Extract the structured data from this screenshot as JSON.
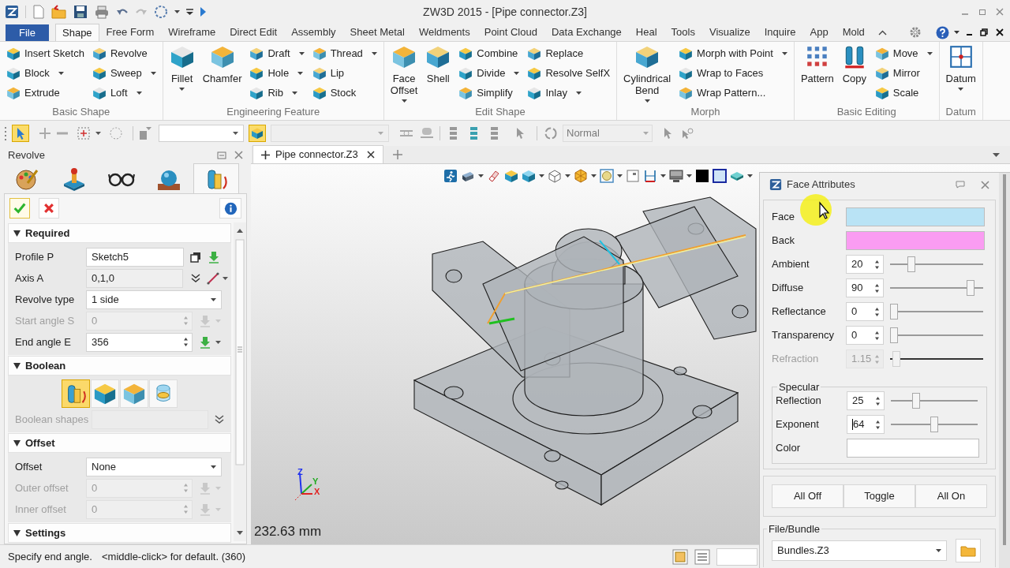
{
  "window": {
    "title": "ZW3D 2015 - [Pipe connector.Z3]"
  },
  "menu_tabs": [
    {
      "label": "File",
      "kind": "file",
      "selected": false
    },
    {
      "label": "Shape",
      "kind": "tab",
      "selected": true
    },
    {
      "label": "Free Form",
      "kind": "tab",
      "selected": false
    },
    {
      "label": "Wireframe",
      "kind": "tab",
      "selected": false
    },
    {
      "label": "Direct Edit",
      "kind": "tab",
      "selected": false
    },
    {
      "label": "Assembly",
      "kind": "tab",
      "selected": false
    },
    {
      "label": "Sheet Metal",
      "kind": "tab",
      "selected": false
    },
    {
      "label": "Weldments",
      "kind": "tab",
      "selected": false
    },
    {
      "label": "Point Cloud",
      "kind": "tab",
      "selected": false
    },
    {
      "label": "Data Exchange",
      "kind": "tab",
      "selected": false
    },
    {
      "label": "Heal",
      "kind": "tab",
      "selected": false
    },
    {
      "label": "Tools",
      "kind": "tab",
      "selected": false
    },
    {
      "label": "Visualize",
      "kind": "tab",
      "selected": false
    },
    {
      "label": "Inquire",
      "kind": "tab",
      "selected": false
    },
    {
      "label": "App",
      "kind": "tab",
      "selected": false
    },
    {
      "label": "Mold",
      "kind": "tab",
      "selected": false
    }
  ],
  "ribbon": {
    "groups": [
      {
        "title": "Basic Shape",
        "items": [
          {
            "label": "Insert Sketch",
            "kind": "small",
            "dropdown": false
          },
          {
            "label": "Block",
            "kind": "small",
            "dropdown": true
          },
          {
            "label": "Extrude",
            "kind": "small",
            "dropdown": false
          },
          {
            "label": "Revolve",
            "kind": "small",
            "dropdown": false
          },
          {
            "label": "Sweep",
            "kind": "small",
            "dropdown": true
          },
          {
            "label": "Loft",
            "kind": "small",
            "dropdown": true
          }
        ]
      },
      {
        "title": "Engineering Feature",
        "items": [
          {
            "label": "Fillet",
            "kind": "large",
            "dropdown": true
          },
          {
            "label": "Chamfer",
            "kind": "large",
            "dropdown": false
          },
          {
            "label": "Draft",
            "kind": "small",
            "dropdown": true
          },
          {
            "label": "Hole",
            "kind": "small",
            "dropdown": true
          },
          {
            "label": "Rib",
            "kind": "small",
            "dropdown": true
          },
          {
            "label": "Thread",
            "kind": "small",
            "dropdown": true
          },
          {
            "label": "Lip",
            "kind": "small",
            "dropdown": false
          },
          {
            "label": "Stock",
            "kind": "small",
            "dropdown": false
          }
        ]
      },
      {
        "title": "Edit Shape",
        "items": [
          {
            "label": "Face Offset",
            "kind": "large",
            "dropdown": true
          },
          {
            "label": "Shell",
            "kind": "large",
            "dropdown": false
          },
          {
            "label": "Combine",
            "kind": "small",
            "dropdown": false
          },
          {
            "label": "Divide",
            "kind": "small",
            "dropdown": true
          },
          {
            "label": "Simplify",
            "kind": "small",
            "dropdown": false
          },
          {
            "label": "Replace",
            "kind": "small",
            "dropdown": false
          },
          {
            "label": "Resolve SelfX",
            "kind": "small",
            "dropdown": false
          },
          {
            "label": "Inlay",
            "kind": "small",
            "dropdown": true
          }
        ]
      },
      {
        "title": "Morph",
        "items": [
          {
            "label": "Cylindrical Bend",
            "kind": "large",
            "dropdown": true
          },
          {
            "label": "Morph with Point",
            "kind": "small",
            "dropdown": true
          },
          {
            "label": "Wrap to Faces",
            "kind": "small",
            "dropdown": false
          },
          {
            "label": "Wrap Pattern...",
            "kind": "small",
            "dropdown": false
          }
        ]
      },
      {
        "title": "Basic Editing",
        "items": [
          {
            "label": "Pattern",
            "kind": "large",
            "dropdown": false
          },
          {
            "label": "Copy",
            "kind": "large",
            "dropdown": false
          },
          {
            "label": "Move",
            "kind": "small",
            "dropdown": true
          },
          {
            "label": "Mirror",
            "kind": "small",
            "dropdown": false
          },
          {
            "label": "Scale",
            "kind": "small",
            "dropdown": false
          }
        ]
      },
      {
        "title": "Datum",
        "items": [
          {
            "label": "Datum",
            "kind": "large",
            "dropdown": true
          }
        ]
      }
    ]
  },
  "toolbar": {
    "mode": {
      "value": "Normal",
      "disabled": true
    }
  },
  "feature_panel": {
    "title": "Revolve",
    "tabs": [
      {
        "selected": false
      },
      {
        "selected": false
      },
      {
        "selected": false
      },
      {
        "selected": false
      },
      {
        "selected": true
      }
    ],
    "sections": [
      {
        "title": "Required",
        "expanded": true,
        "fields": [
          {
            "label": "Profile P",
            "kind": "pick",
            "value": "Sketch5",
            "disabled": false
          },
          {
            "label": "Axis A",
            "kind": "vector",
            "value": "0,1,0",
            "disabled": false
          },
          {
            "label": "Revolve type",
            "kind": "combo",
            "value": "1 side",
            "disabled": false
          },
          {
            "label": "Start angle S",
            "kind": "spin",
            "value": "0",
            "disabled": true
          },
          {
            "label": "End angle E",
            "kind": "spin",
            "value": "356",
            "disabled": false
          }
        ]
      },
      {
        "title": "Boolean",
        "expanded": true,
        "options": [
          {
            "selected": true
          },
          {
            "selected": false
          },
          {
            "selected": false
          },
          {
            "selected": false
          }
        ],
        "fields": [
          {
            "label": "Boolean shapes",
            "kind": "shapes",
            "disabled": true
          }
        ]
      },
      {
        "title": "Offset",
        "expanded": true,
        "fields": [
          {
            "label": "Offset",
            "kind": "combo",
            "value": "None",
            "disabled": false
          },
          {
            "label": "Outer offset",
            "kind": "spin",
            "value": "0",
            "disabled": true
          },
          {
            "label": "Inner offset",
            "kind": "spin",
            "value": "0",
            "disabled": true
          }
        ]
      },
      {
        "title": "Settings",
        "expanded": true
      }
    ]
  },
  "document_tabs": [
    {
      "label": "Pipe connector.Z3",
      "selected": true
    }
  ],
  "viewport": {
    "scale": "232.63 mm",
    "axis_labels": [
      {
        "label": "Z",
        "color": "#2233ee"
      },
      {
        "label": "Y",
        "color": "#22aa22"
      },
      {
        "label": "X",
        "color": "#e02424"
      }
    ]
  },
  "face_attributes": {
    "title": "Face Attributes",
    "rows": [
      {
        "kind": "color",
        "label": "Face",
        "color": "#b9e3f5"
      },
      {
        "kind": "color",
        "label": "Back",
        "color": "#fa9cf2"
      },
      {
        "kind": "slider",
        "label": "Ambient",
        "value": "20",
        "level": 0.2,
        "disabled": false,
        "focused": false
      },
      {
        "kind": "slider",
        "label": "Diffuse",
        "value": "90",
        "level": 0.9,
        "disabled": false,
        "focused": false
      },
      {
        "kind": "slider",
        "label": "Reflectance",
        "value": "0",
        "level": 0,
        "disabled": false,
        "focused": false
      },
      {
        "kind": "slider",
        "label": "Transparency",
        "value": "0",
        "level": 0,
        "disabled": false,
        "focused": false
      },
      {
        "kind": "slider",
        "label": "Refraction",
        "value": "1.15",
        "level": 0.03,
        "disabled": true,
        "focused": false
      }
    ],
    "specular": {
      "title": "Specular",
      "rows": [
        {
          "kind": "slider",
          "label": "Reflection",
          "value": "25",
          "level": 0.27,
          "disabled": false,
          "focused": false
        },
        {
          "kind": "slider",
          "label": "Exponent",
          "value": "64",
          "level": 0.5,
          "disabled": false,
          "focused": true
        },
        {
          "kind": "color",
          "label": "Color",
          "color": "#ffffff"
        }
      ]
    },
    "buttons": [
      "All Off",
      "Toggle",
      "All On"
    ],
    "file_bundle": {
      "title": "File/Bundle",
      "value": "Bundles.Z3"
    }
  },
  "status_bar": {
    "prompt": "Specify end angle.",
    "hint": "<middle-click> for default. (360)"
  }
}
